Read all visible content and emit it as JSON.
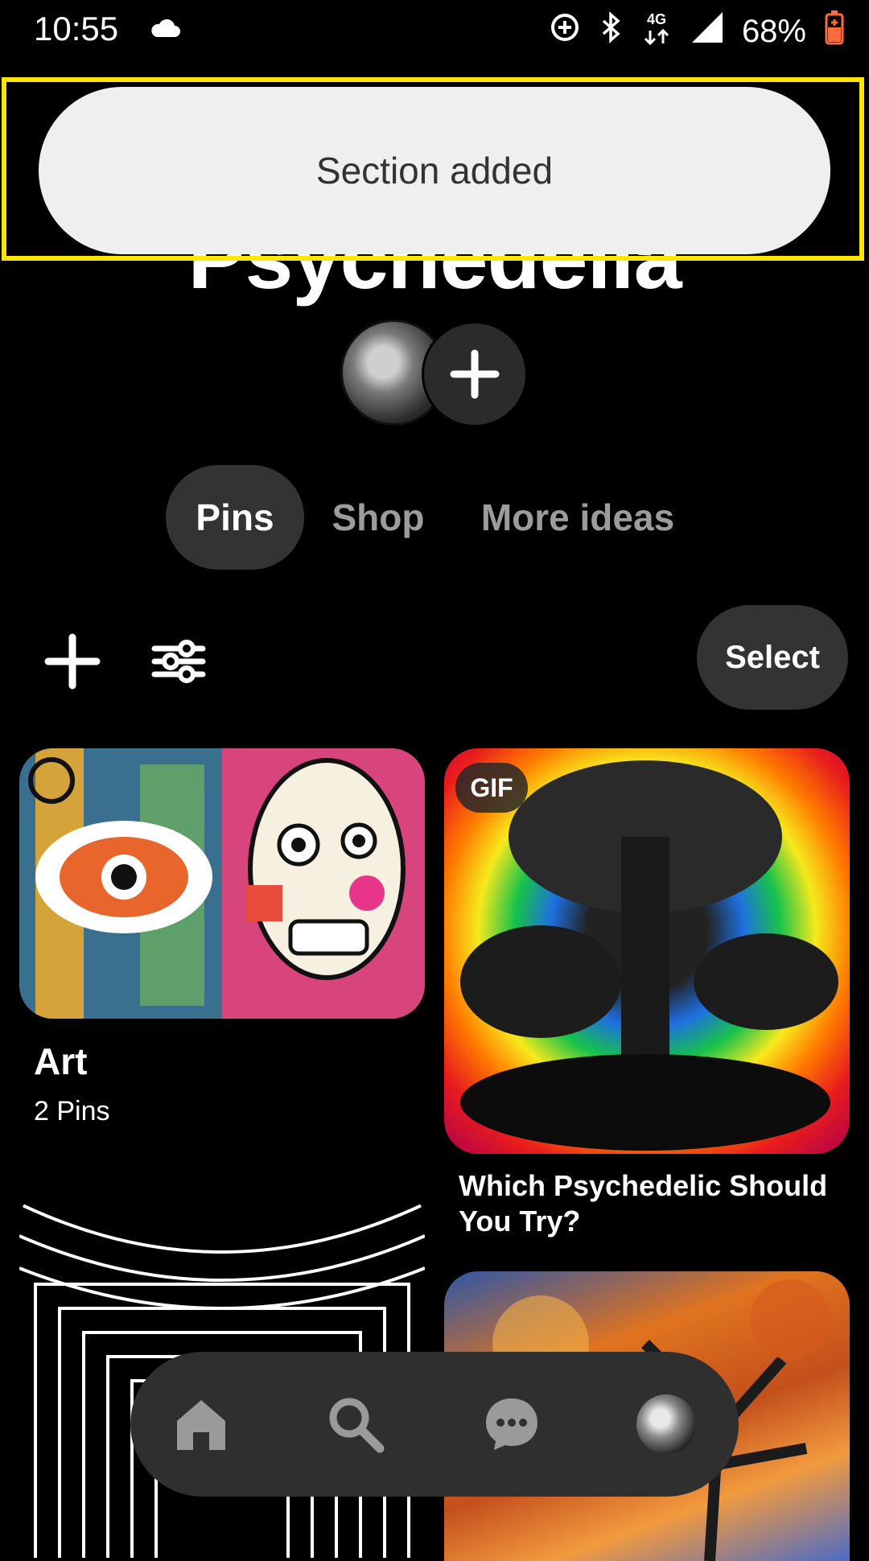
{
  "status_bar": {
    "time": "10:55",
    "network": "4G",
    "battery": "68%",
    "icons": [
      "cloud-icon",
      "data-saver-icon",
      "bluetooth-icon",
      "network-4g-icon",
      "signal-icon",
      "battery-charging-icon"
    ]
  },
  "toast": {
    "message": "Section added"
  },
  "board": {
    "title": "Psychedelia"
  },
  "tabs": [
    {
      "label": "Pins",
      "active": true
    },
    {
      "label": "Shop",
      "active": false
    },
    {
      "label": "More ideas",
      "active": false
    }
  ],
  "toolbar": {
    "select_label": "Select"
  },
  "cards": {
    "art": {
      "title": "Art",
      "count": "2 Pins"
    },
    "gif": {
      "badge": "GIF",
      "title": "Which Psychedelic Should You Try?"
    }
  },
  "bottom_nav": {
    "items": [
      "home-icon",
      "search-icon",
      "messages-icon",
      "profile-avatar"
    ]
  },
  "colors": {
    "accent_highlight": "#ffe600",
    "pill_bg": "#333333",
    "toast_bg": "#efefef"
  }
}
